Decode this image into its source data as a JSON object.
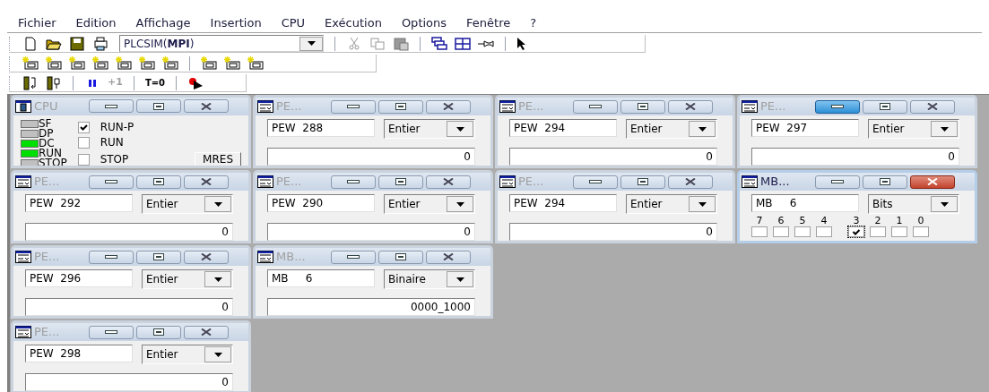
{
  "menu": [
    "Fichier",
    "Edition",
    "Affichage",
    "Insertion",
    "CPU",
    "Exécution",
    "Options",
    "Fenêtre",
    "?"
  ],
  "toolbar": {
    "access_path": "PLCSIM(**MPI**)",
    "step_button": {
      "label": "+1",
      "disabled": true
    },
    "reset_timers_button": {
      "label": "T=0"
    }
  },
  "window_rows": [
    [
      {
        "kind": "cpu",
        "title": "CPU",
        "active": false,
        "minimize_hover": false,
        "leds": [
          {
            "label": "SF",
            "on": false
          },
          {
            "label": "DP",
            "on": false
          },
          {
            "label": "DC",
            "on": true
          },
          {
            "label": "RUN",
            "on": true
          },
          {
            "label": "STOP",
            "on": false
          }
        ],
        "modes": [
          {
            "label": "RUN-P",
            "checked": true
          },
          {
            "label": "RUN",
            "checked": false
          },
          {
            "label": "STOP",
            "checked": false
          }
        ],
        "mres_button": "MRES"
      },
      {
        "kind": "var",
        "title": "PE...",
        "active": false,
        "minimize_hover": false,
        "address": "PEW  288",
        "format": "Entier",
        "value": "0"
      },
      {
        "kind": "var",
        "title": "PE...",
        "active": false,
        "minimize_hover": false,
        "address": "PEW  294",
        "format": "Entier",
        "value": "0"
      },
      {
        "kind": "var",
        "title": "PE...",
        "active": false,
        "minimize_hover": true,
        "address": "PEW  297",
        "format": "Entier",
        "value": "0"
      }
    ],
    [
      {
        "kind": "var",
        "title": "PE...",
        "active": false,
        "minimize_hover": false,
        "address": "PEW  292",
        "format": "Entier",
        "value": "0"
      },
      {
        "kind": "var",
        "title": "PE...",
        "active": false,
        "minimize_hover": false,
        "address": "PEW  290",
        "format": "Entier",
        "value": "0"
      },
      {
        "kind": "var",
        "title": "PE...",
        "active": false,
        "minimize_hover": false,
        "address": "PEW  294",
        "format": "Entier",
        "value": "0"
      },
      {
        "kind": "bits",
        "title": "MB...",
        "active": true,
        "minimize_hover": false,
        "address": "MB     6",
        "format": "Bits",
        "bits": [
          {
            "label": "7",
            "checked": false
          },
          {
            "label": "6",
            "checked": false
          },
          {
            "label": "5",
            "checked": false
          },
          {
            "label": "4",
            "checked": false
          },
          {
            "label": "3",
            "checked": true
          },
          {
            "label": "2",
            "checked": false
          },
          {
            "label": "1",
            "checked": false
          },
          {
            "label": "0",
            "checked": false
          }
        ]
      }
    ],
    [
      {
        "kind": "var",
        "title": "PE...",
        "active": false,
        "minimize_hover": false,
        "address": "PEW  296",
        "format": "Entier",
        "value": "0"
      },
      {
        "kind": "var",
        "title": "MB...",
        "active": false,
        "minimize_hover": false,
        "address": "MB     6",
        "format": "Binaire",
        "value": "0000_1000"
      }
    ],
    [
      {
        "kind": "var",
        "title": "PE...",
        "active": false,
        "minimize_hover": false,
        "address": "PEW  298",
        "format": "Entier",
        "value": "0"
      }
    ]
  ]
}
